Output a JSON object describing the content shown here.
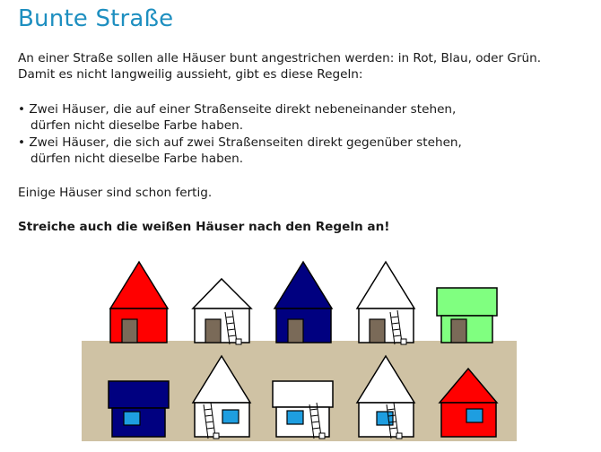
{
  "title": "Bunte Straße",
  "intro": {
    "line1": "An einer Straße sollen alle Häuser bunt angestrichen werden: in Rot, Blau, oder Grün.",
    "line2": "Damit es nicht langweilig aussieht, gibt es diese Regeln:"
  },
  "rules": [
    {
      "line1": "• Zwei Häuser, die auf einer Straßenseite direkt nebeneinander stehen,",
      "line2": "dürfen nicht dieselbe Farbe haben."
    },
    {
      "line1": "• Zwei Häuser, die sich auf zwei Straßenseiten direkt gegenüber stehen,",
      "line2": "dürfen nicht dieselbe Farbe haben."
    }
  ],
  "status_text": "Einige Häuser sind schon fertig.",
  "instruction": "Streiche auch die weißen Häuser nach den Regeln an!",
  "colors": {
    "title": "#1e8fc0",
    "road": "#cfc2a4",
    "red": "#ff0000",
    "blue": "#000080",
    "green": "#80ff80",
    "white": "#ffffff",
    "door": "#7a6a58",
    "window": "#1e9ee0"
  },
  "houses": {
    "top_row": [
      {
        "color": "red",
        "painted": true,
        "has_ladder": false
      },
      {
        "color": "white",
        "painted": false,
        "has_ladder": true
      },
      {
        "color": "blue",
        "painted": true,
        "has_ladder": false
      },
      {
        "color": "white",
        "painted": false,
        "has_ladder": true
      },
      {
        "color": "green",
        "painted": true,
        "has_ladder": false
      }
    ],
    "bottom_row": [
      {
        "color": "blue",
        "painted": true,
        "has_ladder": false
      },
      {
        "color": "white",
        "painted": false,
        "has_ladder": true
      },
      {
        "color": "white",
        "painted": false,
        "has_ladder": true
      },
      {
        "color": "white",
        "painted": false,
        "has_ladder": true
      },
      {
        "color": "red",
        "painted": true,
        "has_ladder": false
      }
    ]
  }
}
